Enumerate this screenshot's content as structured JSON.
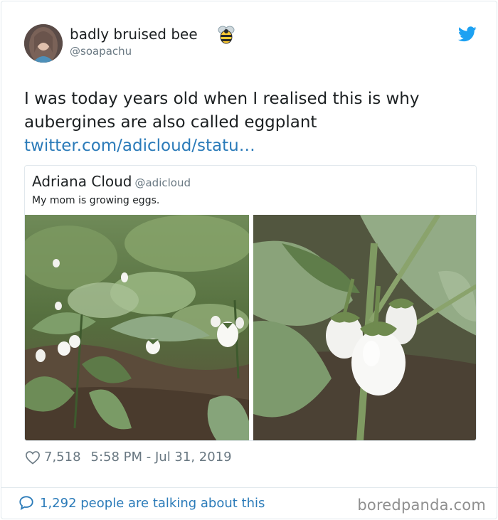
{
  "author": {
    "display_name": "badly bruised bee",
    "handle": "@soapachu",
    "emoji_icon": "bee-icon"
  },
  "brand_icon": "twitter-bird-icon",
  "tweet": {
    "text": "I was today years old when I realised this is why aubergines are also called eggplant",
    "link": "twitter.com/adicloud/statu…"
  },
  "quoted_tweet": {
    "display_name": "Adriana Cloud",
    "handle": "@adicloud",
    "text": "My mom is growing eggs."
  },
  "stats": {
    "likes": "7,518",
    "timestamp": "5:58 PM - Jul 31, 2019"
  },
  "conversation": {
    "label": "1,292 people are talking about this"
  },
  "watermark": "boredpanda.com",
  "colors": {
    "link": "#2b7bb9",
    "muted": "#697882",
    "twitter_blue": "#1da1f2"
  }
}
